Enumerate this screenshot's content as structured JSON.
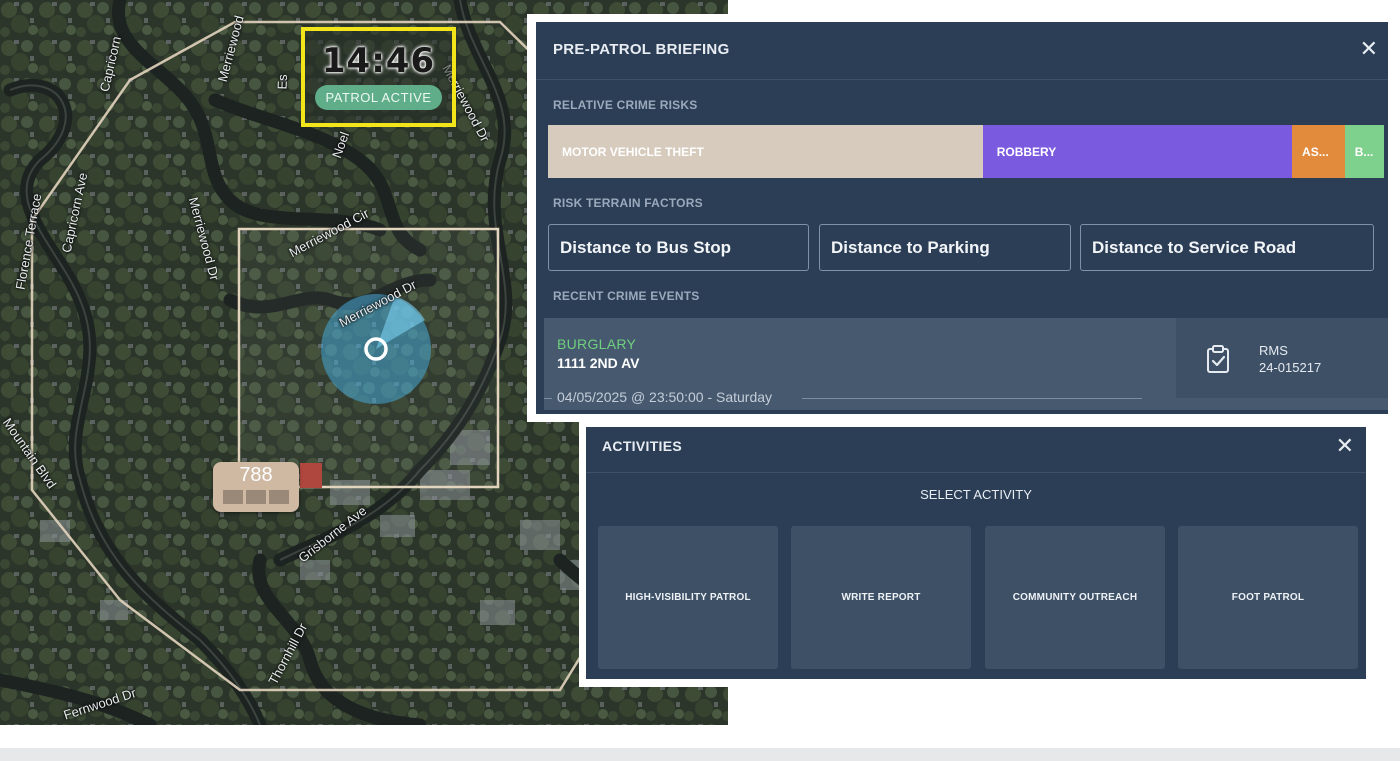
{
  "map": {
    "timer": "14:46",
    "patrol_status": "PATROL ACTIVE",
    "unit_badge": "788",
    "street_labels": {
      "capricorn_ave_top": "Capricorn",
      "capricorn_ave_left": "Capricorn Ave",
      "florence_terrace": "Florence Terrace",
      "merriewood_dr_vertical": "Merriewood Dr",
      "merriewood_cir": "Merriewood Cir",
      "merriewood_dr_right": "Merriewood Dr",
      "merriewood_dr_top": "Merriewood",
      "merriewood_dr_center": "Merriewood Dr",
      "noel": "Noel",
      "mountain_blvd": "Mountain Blvd",
      "grisborne_ave": "Grisborne Ave",
      "thornhill_dr": "Thornhill Dr",
      "fernwood_dr": "Fernwood Dr",
      "estates": "Es"
    }
  },
  "briefing": {
    "title": "PRE-PATROL BRIEFING",
    "close_icon": "close-icon",
    "relative_crime_risks_label": "RELATIVE CRIME RISKS",
    "crime_risks": [
      {
        "label": "MOTOR VEHICLE THEFT",
        "share": 0.52,
        "color": "#d6cbbd"
      },
      {
        "label": "ROBBERY",
        "share": 0.37,
        "color": "#7a5be0"
      },
      {
        "label": "AS...",
        "share": 0.063,
        "color": "#e38b3c"
      },
      {
        "label": "B...",
        "share": 0.047,
        "color": "#7ed18c"
      }
    ],
    "risk_terrain_label": "RISK TERRAIN FACTORS",
    "risk_factors": [
      "Distance to Bus Stop",
      "Distance to Parking",
      "Distance to Service Road"
    ],
    "recent_events_label": "RECENT CRIME EVENTS",
    "event": {
      "type": "BURGLARY",
      "address": "1111 2ND AV",
      "datetime": "04/05/2025 @ 23:50:00 - Saturday",
      "rms_label": "RMS",
      "rms_number": "24-015217",
      "icon": "clipboard-check-icon"
    }
  },
  "activities": {
    "title": "ACTIVITIES",
    "close_icon": "close-icon",
    "prompt": "SELECT ACTIVITY",
    "options": [
      "HIGH-VISIBILITY PATROL",
      "WRITE REPORT",
      "COMMUNITY OUTREACH",
      "FOOT PATROL"
    ]
  },
  "colors": {
    "panel_bg": "#2c3e55",
    "card_bg": "#3d5066",
    "timer_border": "#f2e51a",
    "patrol_badge": "#5fae89",
    "burglary_green": "#6fd07d"
  }
}
